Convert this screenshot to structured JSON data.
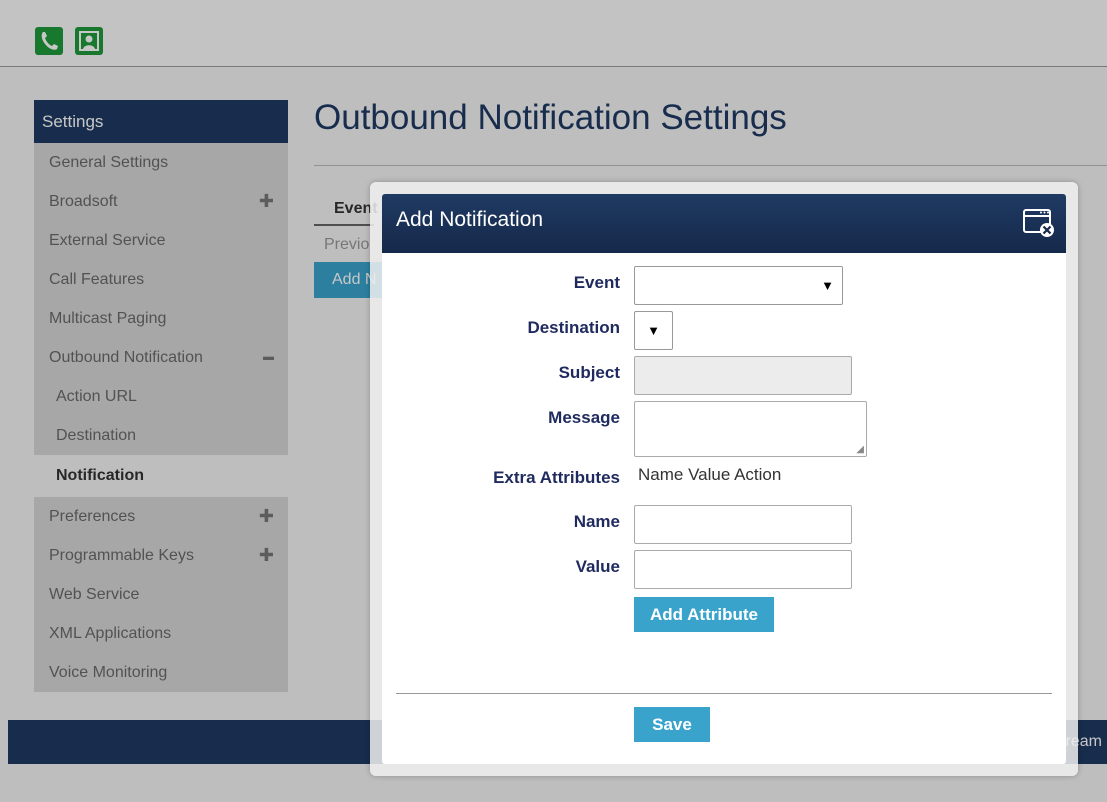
{
  "sidebar": {
    "header": "Settings",
    "items": [
      {
        "label": "General Settings"
      },
      {
        "label": "Broadsoft",
        "toggle": "✚"
      },
      {
        "label": "External Service"
      },
      {
        "label": "Call Features"
      },
      {
        "label": "Multicast Paging"
      },
      {
        "label": "Outbound Notification",
        "toggle": "▬"
      },
      {
        "label": "Action URL"
      },
      {
        "label": "Destination"
      },
      {
        "label": "Notification"
      },
      {
        "label": "Preferences",
        "toggle": "✚"
      },
      {
        "label": "Programmable Keys",
        "toggle": "✚"
      },
      {
        "label": "Web Service"
      },
      {
        "label": "XML Applications"
      },
      {
        "label": "Voice Monitoring"
      }
    ]
  },
  "page": {
    "title": "Outbound Notification Settings",
    "tab_fragment": "Event",
    "prev_fragment": "Previo",
    "add_fragment": "Add N",
    "footer_fragment": "ream"
  },
  "modal": {
    "title": "Add Notification",
    "close_icon": "close-window-icon",
    "fields": {
      "event": {
        "label": "Event",
        "value": ""
      },
      "destination": {
        "label": "Destination",
        "value": ""
      },
      "subject": {
        "label": "Subject",
        "value": ""
      },
      "message": {
        "label": "Message",
        "value": ""
      },
      "extra_attributes": {
        "label": "Extra Attributes",
        "columns": "Name Value Action"
      },
      "name": {
        "label": "Name",
        "value": ""
      },
      "value": {
        "label": "Value",
        "value": ""
      }
    },
    "add_attribute_label": "Add Attribute",
    "save_label": "Save"
  },
  "colors": {
    "nav_dark": "#1f3a63",
    "accent": "#3aa3cc",
    "label": "#1f2a5e"
  }
}
